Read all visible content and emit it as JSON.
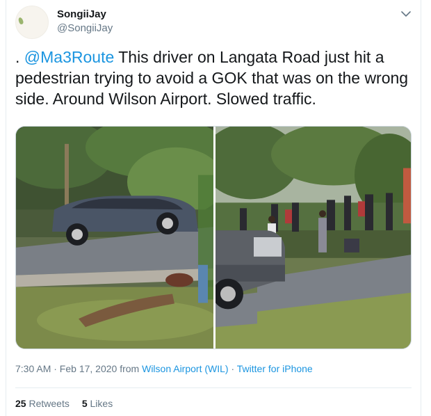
{
  "tweet": {
    "display_name": "SongiiJay",
    "handle": "@SongiiJay",
    "text_prefix": ". ",
    "mention": "@Ma3Route",
    "text_body": " This driver on Langata Road just hit a pedestrian trying to avoid a GOK that was on the wrong side. Around Wilson Airport. Slowed traffic.",
    "timestamp": "7:30 AM · Feb 17, 2020",
    "from_word": " from ",
    "location": "Wilson Airport (WIL)",
    "separator": " · ",
    "source": "Twitter for iPhone",
    "retweet_count": "25",
    "retweet_label": "Retweets",
    "like_count": "5",
    "like_label": "Likes"
  },
  "icons": {
    "menu": "chevron-down-icon",
    "avatar": "avatar"
  },
  "colors": {
    "link": "#1b95e0",
    "secondary_text": "#657786",
    "primary_text": "#14171a",
    "border": "#e6ecf0"
  }
}
